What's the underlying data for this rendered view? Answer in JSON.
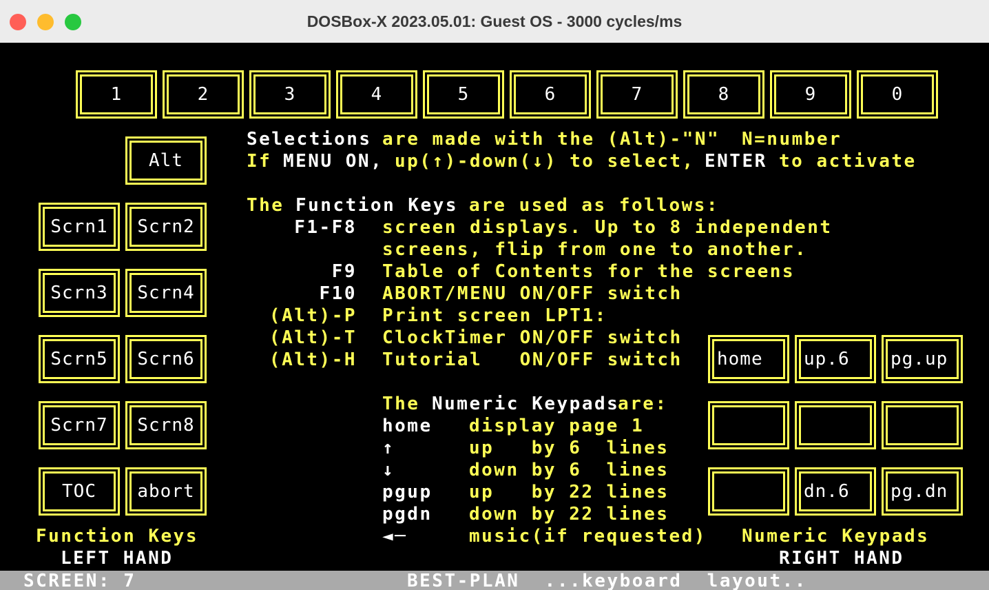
{
  "window": {
    "title": "DOSBox-X 2023.05.01: Guest OS - 3000 cycles/ms",
    "colors": {
      "close": "#ff5f57",
      "minimize": "#febc2e",
      "zoom": "#28c840"
    }
  },
  "colors": {
    "background": "#000000",
    "accent": "#ffff55",
    "text": "#ffffff",
    "statusbar": "#aaaaaa"
  },
  "number_keys": [
    "1",
    "2",
    "3",
    "4",
    "5",
    "6",
    "7",
    "8",
    "9",
    "0"
  ],
  "alt_key": "Alt",
  "function_keys": [
    "Scrn1",
    "Scrn2",
    "Scrn3",
    "Scrn4",
    "Scrn5",
    "Scrn6",
    "Scrn7",
    "Scrn8",
    "TOC",
    "abort"
  ],
  "keypad_keys": [
    "home",
    "up.6",
    "pg.up",
    "",
    "",
    "",
    "",
    "dn.6",
    "pg.dn"
  ],
  "instructions": {
    "line1a": "Selections",
    "line1b": "are made with the (Alt)-\"N\"",
    "line1c": "N=number",
    "line2a": "If",
    "line2b": "MENU ON,",
    "line2c": "up(↑)-down(↓) to select,",
    "line2d": "ENTER",
    "line2e": "to activate"
  },
  "function_section": {
    "title_a": "The",
    "title_b": "Function Keys",
    "title_c": "are used as follows:",
    "rows": [
      {
        "key": "F1-F8",
        "desc": "screen displays. Up to 8 independent"
      },
      {
        "key": "",
        "desc": "screens, flip from one to another."
      },
      {
        "key": "F9",
        "desc": "Table of Contents for the screens"
      },
      {
        "key": "F10",
        "desc": "ABORT/MENU ON/OFF switch"
      },
      {
        "key": "(Alt)-P",
        "desc": "Print screen LPT1:"
      },
      {
        "key": "(Alt)-T",
        "desc": "ClockTimer ON/OFF switch"
      },
      {
        "key": "(Alt)-H",
        "desc": "Tutorial   ON/OFF switch"
      }
    ]
  },
  "keypad_section": {
    "title_a": "The",
    "title_b": "Numeric Keypads",
    "title_c": "are:",
    "rows": [
      {
        "key": "home",
        "desc": "display page 1"
      },
      {
        "key": "↑",
        "desc": "up   by 6  lines"
      },
      {
        "key": "↓",
        "desc": "down by 6  lines"
      },
      {
        "key": "pgup",
        "desc": "up   by 22 lines"
      },
      {
        "key": "pgdn",
        "desc": "down by 22 lines"
      },
      {
        "key": "◄─",
        "desc": "music(if requested)"
      }
    ]
  },
  "left_caption": {
    "line1": "Function Keys",
    "line2": "LEFT HAND"
  },
  "right_caption": {
    "line1": "Numeric Keypads",
    "line2": "RIGHT HAND"
  },
  "status_bar": {
    "screen": "SCREEN: 7",
    "message": "BEST-PLAN  ...keyboard  layout.."
  }
}
